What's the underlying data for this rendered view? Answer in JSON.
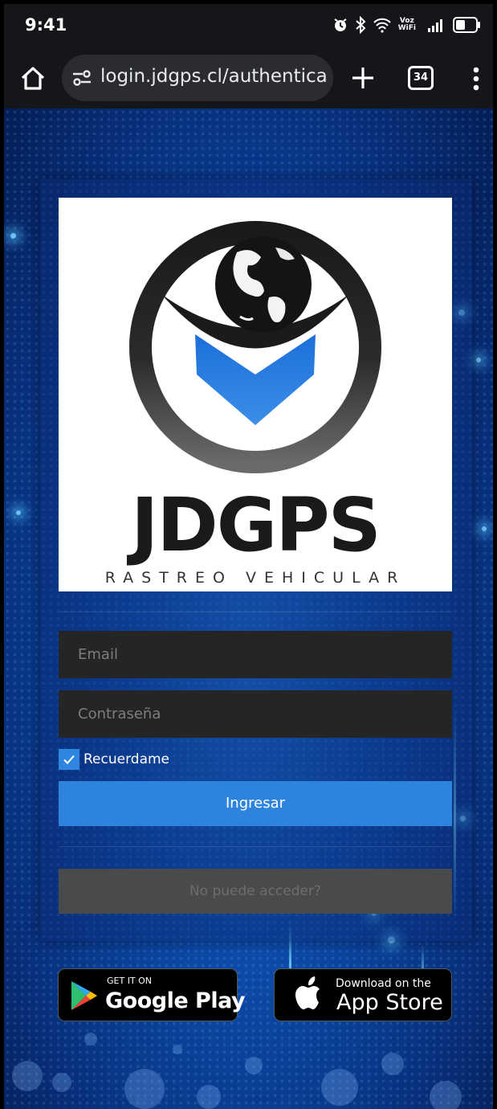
{
  "status_bar": {
    "time": "9:41",
    "wifi_label_top": "Voz",
    "wifi_label_bottom": "WiFi",
    "icons": [
      "alarm-icon",
      "bluetooth-icon",
      "wifi-icon",
      "signal-icon",
      "battery-icon"
    ]
  },
  "browser": {
    "url": "login.jdgps.cl/authentica",
    "tab_count": "34",
    "icons": [
      "home-icon",
      "site-settings-icon",
      "plus-icon",
      "tabs-icon",
      "more-vert-icon"
    ]
  },
  "logo": {
    "brand": "JDGPS",
    "tagline": "RASTREO VEHICULAR"
  },
  "login": {
    "email_placeholder": "Email",
    "password_placeholder": "Contraseña",
    "remember_label": "Recuerdame",
    "remember_checked": true,
    "submit_label": "Ingresar",
    "help_label": "No puede acceder?"
  },
  "stores": {
    "google": {
      "small": "GET IT ON",
      "big": "Google Play"
    },
    "apple": {
      "small": "Download on the",
      "big": "App Store"
    }
  },
  "colors": {
    "accent": "#2e84dd",
    "field_bg": "#252525",
    "help_bg": "#4a4a4a",
    "logo_blue": "#2a7de1"
  }
}
